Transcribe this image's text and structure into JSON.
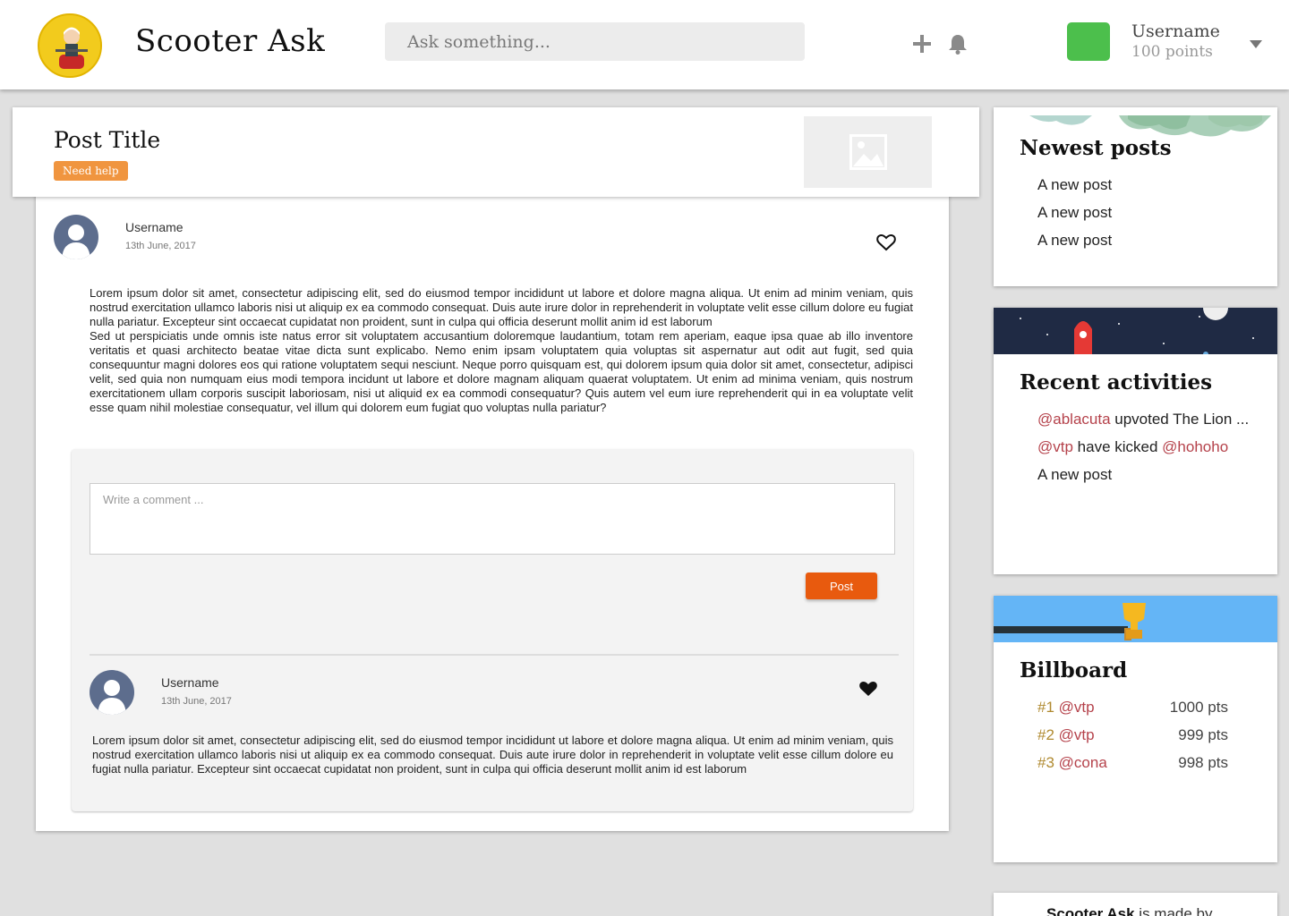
{
  "header": {
    "app_title": "Scooter Ask",
    "search_placeholder": "Ask something...",
    "icons": [
      "logo-icon",
      "plus-icon",
      "bell-icon",
      "chevron-down-icon"
    ],
    "user": {
      "name": "Username",
      "points": "100 points",
      "avatar_color": "#4cbf4c"
    }
  },
  "post": {
    "title": "Post Title",
    "tag": "Need help",
    "author": "Username",
    "date": "13th June, 2017",
    "body_p1": "Lorem ipsum dolor sit amet, consectetur adipiscing elit, sed do eiusmod tempor incididunt ut labore et dolore magna aliqua. Ut enim ad minim veniam, quis nostrud exercitation ullamco laboris nisi ut aliquip ex ea commodo consequat. Duis aute irure dolor in reprehenderit in voluptate velit esse cillum dolore eu fugiat nulla pariatur. Excepteur sint occaecat cupidatat non proident, sunt in culpa qui officia deserunt mollit anim id est laborum",
    "body_p2": "Sed ut perspiciatis unde omnis iste natus error sit voluptatem accusantium doloremque laudantium, totam rem aperiam, eaque ipsa quae ab illo inventore veritatis et quasi architecto beatae vitae dicta sunt explicabo. Nemo enim ipsam voluptatem quia voluptas sit aspernatur aut odit aut fugit, sed quia consequuntur magni dolores eos qui ratione voluptatem sequi nesciunt. Neque porro quisquam est, qui dolorem ipsum quia dolor sit amet, consectetur, adipisci velit, sed quia non numquam eius modi tempora incidunt ut labore et dolore magnam aliquam quaerat voluptatem. Ut enim ad minima veniam, quis nostrum exercitationem ullam corporis suscipit laboriosam, nisi ut aliquid ex ea commodi consequatur? Quis autem vel eum iure reprehenderit qui in ea voluptate velit esse quam nihil molestiae consequatur, vel illum qui dolorem eum fugiat quo voluptas nulla pariatur?",
    "liked": false
  },
  "comment_form": {
    "placeholder": "Write a comment ...",
    "submit_label": "Post"
  },
  "comments": [
    {
      "author": "Username",
      "date": "13th June, 2017",
      "liked": true,
      "body": "Lorem ipsum dolor sit amet, consectetur adipiscing elit, sed do eiusmod tempor incididunt ut labore et dolore magna aliqua. Ut enim ad minim veniam, quis nostrud exercitation ullamco laboris nisi ut aliquip ex ea commodo consequat. Duis aute irure dolor in reprehenderit in voluptate velit esse cillum dolore eu fugiat nulla pariatur. Excepteur sint occaecat cupidatat non proident, sunt in culpa qui officia deserunt mollit anim id est laborum"
    }
  ],
  "sidebar": {
    "newest_posts": {
      "heading": "Newest posts",
      "items": [
        "A new post",
        "A new post",
        "A new post"
      ]
    },
    "recent_activities": {
      "heading": "Recent activities",
      "item1": {
        "mention": "@ablacuta",
        "text": " upvoted The Lion ..."
      },
      "item2": {
        "mention": "@vtp",
        "text": " have kicked ",
        "mention2": "@hohoho"
      },
      "item3": "A new post"
    },
    "billboard": {
      "heading": "Billboard",
      "rows": [
        {
          "rank": "#1",
          "user": "@vtp",
          "points": "1000 pts"
        },
        {
          "rank": "#2",
          "user": "@vtp",
          "points": "999 pts"
        },
        {
          "rank": "#3",
          "user": "@cona",
          "points": "998 pts"
        }
      ]
    },
    "footer": {
      "brand": "Scooter Ask",
      "text": " is made by"
    }
  },
  "colors": {
    "accent_orange": "#e85a0e",
    "tag_orange": "#f0953f",
    "mention_red": "#b5424b",
    "rank_gold": "#b08a30"
  }
}
